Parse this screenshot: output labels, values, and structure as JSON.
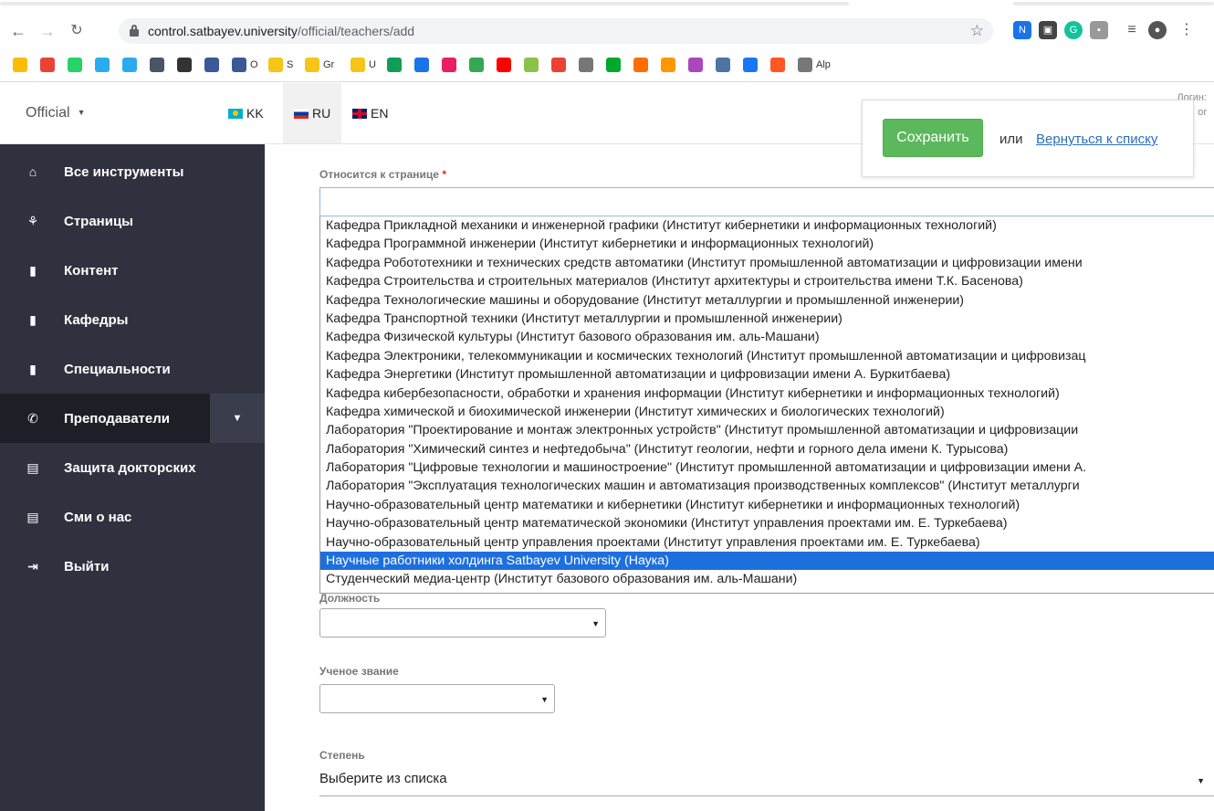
{
  "browser": {
    "url_host": "control.satbayev.university",
    "url_path": "/official/teachers/add",
    "bookmarks": [
      {
        "label": "",
        "color": "#fbbc04"
      },
      {
        "label": "",
        "color": "#ea4335"
      },
      {
        "label": "",
        "color": "#25d366"
      },
      {
        "label": "",
        "color": "#2aabee"
      },
      {
        "label": "",
        "color": "#2aabee"
      },
      {
        "label": "",
        "color": "#4a5566"
      },
      {
        "label": "",
        "color": "#333333"
      },
      {
        "label": "",
        "color": "#3b5998"
      },
      {
        "label": "O",
        "color": "#3b5998"
      },
      {
        "label": "S",
        "color": "#f5c518"
      },
      {
        "label": "Gr",
        "color": "#f5c518"
      },
      {
        "label": "U",
        "color": "#f5c518"
      },
      {
        "label": "",
        "color": "#0f9d58"
      },
      {
        "label": "",
        "color": "#1a73e8"
      },
      {
        "label": "",
        "color": "#e91e63"
      },
      {
        "label": "",
        "color": "#34a853"
      },
      {
        "label": "",
        "color": "#ff0000"
      },
      {
        "label": "",
        "color": "#8bc34a"
      },
      {
        "label": "",
        "color": "#ea4335"
      },
      {
        "label": "",
        "color": "#777777"
      },
      {
        "label": "",
        "color": "#00a82d"
      },
      {
        "label": "",
        "color": "#ff6d00"
      },
      {
        "label": "",
        "color": "#ff9800"
      },
      {
        "label": "",
        "color": "#ab47bc"
      },
      {
        "label": "",
        "color": "#4c75a3"
      },
      {
        "label": "",
        "color": "#1877f2"
      },
      {
        "label": "",
        "color": "#ff5722"
      },
      {
        "label": "Alp",
        "color": "#777777"
      }
    ]
  },
  "header": {
    "menu_label": "Official",
    "languages": [
      {
        "code": "KK"
      },
      {
        "code": "RU"
      },
      {
        "code": "EN"
      }
    ],
    "login_label": "Логин:",
    "login_value": "or"
  },
  "save_box": {
    "save_label": "Сохранить",
    "or_label": "или",
    "back_label": "Вернуться к списку"
  },
  "sidebar": {
    "items": [
      {
        "label": "Все инструменты",
        "icon": "home-icon",
        "glyph": "⌂"
      },
      {
        "label": "Страницы",
        "icon": "sitemap-icon",
        "glyph": "⚘"
      },
      {
        "label": "Контент",
        "icon": "file-icon",
        "glyph": "▮"
      },
      {
        "label": "Кафедры",
        "icon": "file-icon",
        "glyph": "▮"
      },
      {
        "label": "Специальности",
        "icon": "file-icon",
        "glyph": "▮"
      },
      {
        "label": "Преподаватели",
        "icon": "phone-icon",
        "glyph": "✆"
      },
      {
        "label": "Защита докторских",
        "icon": "table-icon",
        "glyph": "▤"
      },
      {
        "label": "Сми о нас",
        "icon": "table-icon",
        "glyph": "▤"
      },
      {
        "label": "Выйти",
        "icon": "logout-icon",
        "glyph": "⇥"
      }
    ]
  },
  "form": {
    "page_label": "Относится к странице",
    "required_mark": "*",
    "page_input_value": "",
    "options": [
      "Кафедра Прикладной механики и инженерной графики (Институт кибернетики и информационных технологий)",
      "Кафедра Программной инженерии (Институт кибернетики и информационных технологий)",
      "Кафедра Робототехники и технических средств автоматики (Институт промышленной автоматизации и цифровизации имени",
      "Кафедра Строительства и строительных материалов (Институт архитектуры и строительства имени Т.К. Басенова)",
      "Кафедра Технологические машины и оборудование (Институт металлургии и промышленной инженерии)",
      "Кафедра Транспортной техники (Институт металлургии и промышленной инженерии)",
      "Кафедра Физической культуры (Институт базового образования им. аль-Машани)",
      "Кафедра Электроники, телекоммуникации и космических технологий (Институт промышленной автоматизации и цифровизац",
      "Кафедра Энергетики (Институт промышленной автоматизации и цифровизации имени А. Буркитбаева)",
      "Кафедра кибербезопасности, обработки и хранения информации (Институт кибернетики и информационных технологий)",
      "Кафедра химической и биохимической инженерии (Институт химических и биологических технологий)",
      "Лаборатория \"Проектирование и монтаж электронных устройств\" (Институт промышленной автоматизации и цифровизации",
      "Лаборатория \"Химический синтез и нефтедобыча\" (Институт геологии, нефти и горного дела имени К. Турысова)",
      "Лаборатория \"Цифровые технологии и машиностроение\" (Институт промышленной автоматизации и цифровизации имени А.",
      "Лаборатория \"Эксплуатация технологических машин и автоматизация производственных комплексов\" (Институт металлурги",
      "Научно-образовательный центр математики и кибернетики (Институт кибернетики и информационных технологий)",
      "Научно-образовательный центр математической экономики (Институт управления проектами им. Е. Туркебаева)",
      "Научно-образовательный центр управления проектами (Институт управления проектами им. Е. Туркебаева)",
      "Научные работники холдинга Satbayev University (Наука)",
      "Студенческий медиа-центр (Институт базового образования им. аль-Машани)"
    ],
    "selected_index": 18,
    "position_label": "Должность",
    "position_value": "",
    "title_label": "Ученое звание",
    "title_value": "",
    "degree_label": "Степень",
    "degree_value": "Выберите из списка"
  }
}
